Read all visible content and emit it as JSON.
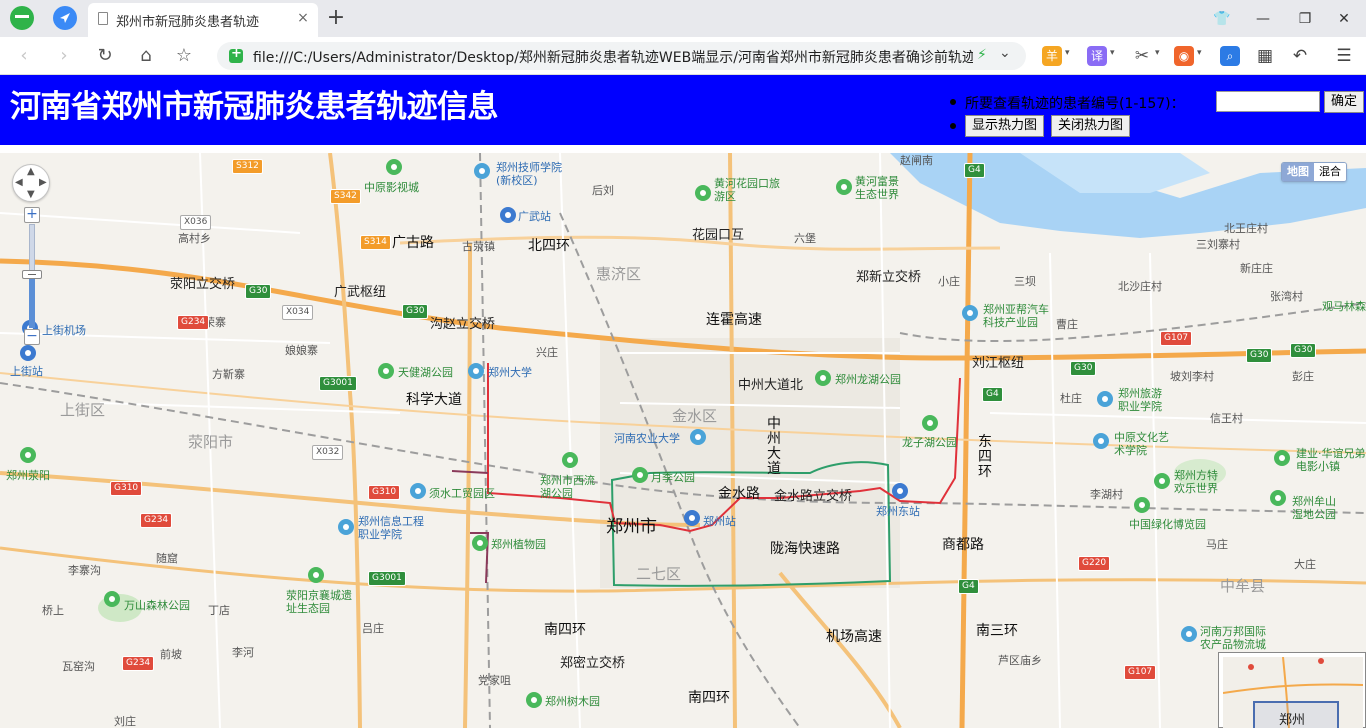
{
  "browser": {
    "tab_title": "郑州市新冠肺炎患者轨迹",
    "tab_close": "×",
    "new_tab": "+",
    "url": "file:///C:/Users/Administrator/Desktop/郑州新冠肺炎患者轨迹WEB端显示/河南省郑州市新冠肺炎患者确诊前轨迹",
    "window_controls": {
      "skin": "👕",
      "minimize": "—",
      "restore": "❐",
      "close": "✕"
    },
    "nav": {
      "back": "‹",
      "forward": "›",
      "reload": "↻",
      "home": "⌂",
      "favorite": "☆"
    },
    "extensions": [
      {
        "name": "coin-ext-icon",
        "glyph": "羊",
        "color": "#f5a623"
      },
      {
        "name": "translate-ext-icon",
        "glyph": "译",
        "color": "#8a6cf5"
      },
      {
        "name": "scissors-ext-icon",
        "glyph": "✂",
        "color": "#555555"
      },
      {
        "name": "game-ext-icon",
        "glyph": "◉",
        "color": "#f0652b"
      },
      {
        "name": "search-ext-icon",
        "glyph": "⌕",
        "color": "#2c7be5"
      },
      {
        "name": "apps-ext-icon",
        "glyph": "▦",
        "color": "#444444"
      },
      {
        "name": "undo-ext-icon",
        "glyph": "↶",
        "color": "#444444"
      },
      {
        "name": "menu-ext-icon",
        "glyph": "☰",
        "color": "#444444"
      }
    ]
  },
  "header": {
    "title": "河南省郑州市新冠肺炎患者轨迹信息",
    "patient_prompt": "所要查看轨迹的患者编号(1-157)：",
    "patient_input_value": "",
    "confirm_label": "确定",
    "show_heat_label": "显示热力图",
    "close_heat_label": "关闭热力图",
    "bg_color": "#0000ff"
  },
  "map": {
    "type_buttons": {
      "map": "地图",
      "hybrid": "混合"
    },
    "zoom": {
      "in": "+",
      "out": "−",
      "level_fraction": 0.52
    },
    "overview_label": "郑州",
    "districts": [
      "上街区",
      "荥阳市",
      "金水区",
      "惠济区",
      "二七区",
      "中牟县"
    ],
    "city": "郑州市",
    "roads": [
      "北四环",
      "广古路",
      "连霍高速",
      "科学大道",
      "中州大道",
      "金水路",
      "陇海快速路",
      "商都路",
      "南四环",
      "南三环",
      "机场高速",
      "东四环",
      "金水路立交桥",
      "中州大道北",
      "花园口互",
      "郑新立交桥",
      "刘江枢纽",
      "荥阳立交桥",
      "广武枢纽",
      "沟赵立交桥",
      "郑密立交桥",
      "南四环"
    ],
    "pois": [
      "中原影视城",
      "郑州技师学院(新校区)",
      "广武站",
      "黄河花园口旅游区",
      "黄河富景生态世界",
      "郑州亚帮汽车科技产业园",
      "上街机场",
      "上街站",
      "天健湖公园",
      "郑州大学",
      "郑州龙湖公园",
      "郑州旅游职业学院",
      "河南农业大学",
      "龙子湖公园",
      "中原文化艺术学院",
      "郑州市西流湖公园",
      "月季公园",
      "须水工贸园区",
      "郑州站",
      "郑州东站",
      "郑州方特欢乐世界",
      "郑州信息工程职业学院",
      "郑州植物园",
      "中国绿化博览园",
      "建业·华谊兄弟电影小镇",
      "郑州牟山湿地公园",
      "郑州荥阳",
      "荥阳京襄城遗址生态园",
      "万山森林公园",
      "河南万邦国际农产品物流城",
      "郑州树木园",
      "观马林森"
    ],
    "villages": [
      "高村乡",
      "荥阳立交桥",
      "荣寨",
      "娘娘寨",
      "方靳寨",
      "后刘",
      "古荥镇",
      "六堡",
      "小庄",
      "三坝",
      "北沙庄村",
      "北王庄村",
      "三刘寨村",
      "新庄庄",
      "张湾村",
      "曹庄",
      "坡刘李村",
      "彭庄",
      "杜庄",
      "信王村",
      "李湖村",
      "李寨沟",
      "随窟",
      "丁店",
      "桥上",
      "前坡",
      "李河",
      "吕庄",
      "瓦窑沟",
      "党家咀",
      "芦区庙乡",
      "马庄",
      "刘庄",
      "赵闸南",
      "兴庄",
      "大庄"
    ],
    "shields": [
      "S312",
      "S342",
      "S314",
      "G30",
      "G234",
      "G3001",
      "G310",
      "G4",
      "G107",
      "G220",
      "X036",
      "X034",
      "X032"
    ]
  }
}
